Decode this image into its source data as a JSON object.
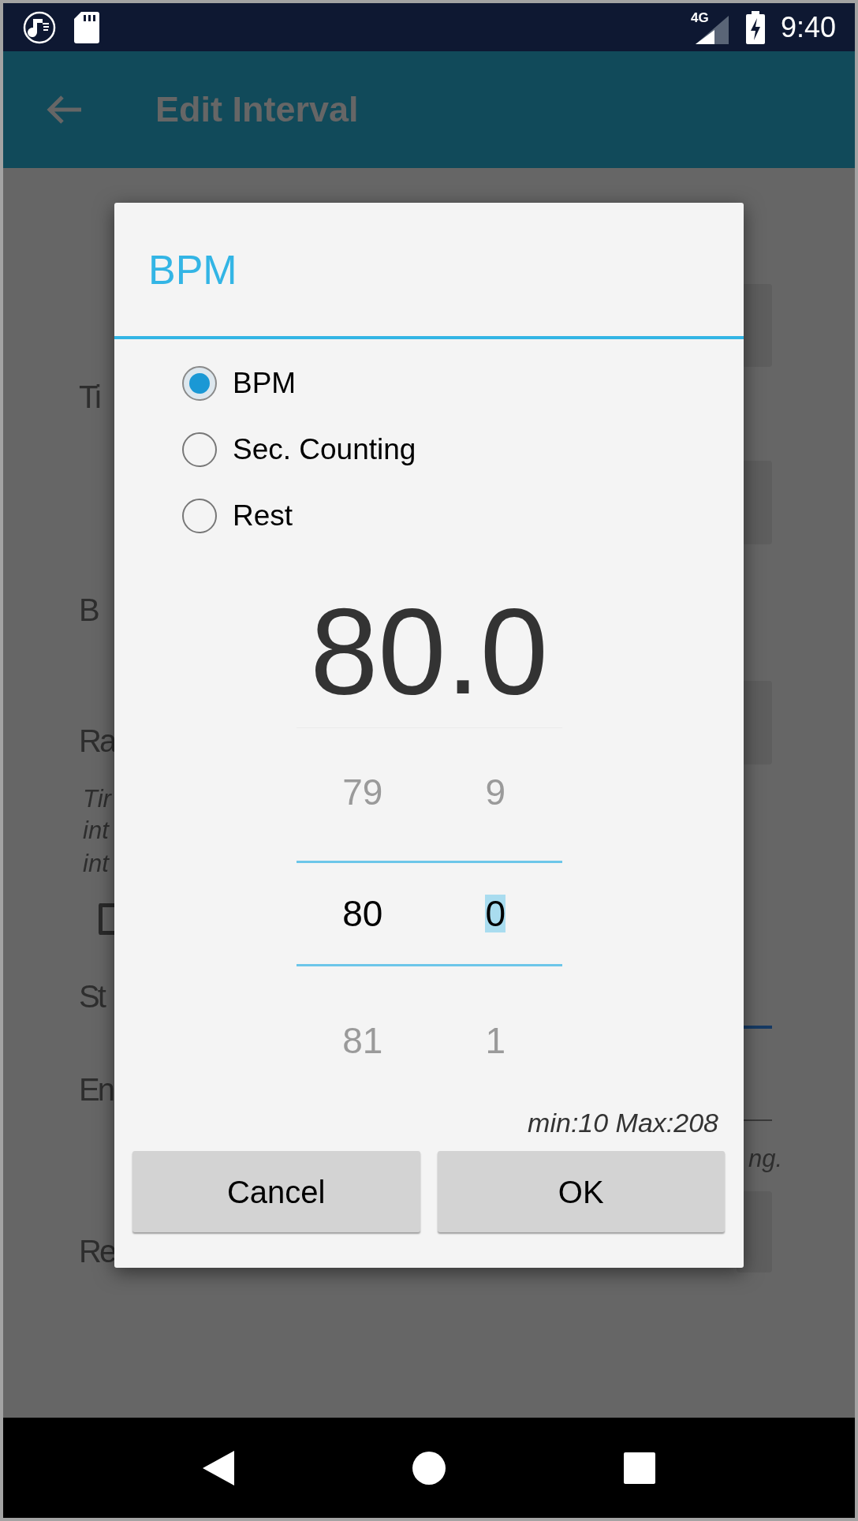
{
  "status_bar": {
    "network": "4G",
    "time": "9:40"
  },
  "app_bar": {
    "title": "Edit Interval"
  },
  "background": {
    "left": [
      {
        "kind": "label",
        "text": "Ti"
      },
      {
        "kind": "label",
        "text": "B"
      },
      {
        "kind": "label",
        "text": "Ra"
      },
      {
        "kind": "hint",
        "text": "Tir"
      },
      {
        "kind": "hint",
        "text": "int"
      },
      {
        "kind": "hint",
        "text": "int"
      },
      {
        "kind": "checkbox",
        "checked": false
      },
      {
        "kind": "label",
        "text": "St"
      },
      {
        "kind": "label",
        "text": "En"
      },
      {
        "kind": "label",
        "text": "Re"
      }
    ],
    "right_hint": "ng."
  },
  "dialog": {
    "title": "BPM",
    "options": [
      {
        "label": "BPM",
        "selected": true
      },
      {
        "label": "Sec. Counting",
        "selected": false
      },
      {
        "label": "Rest",
        "selected": false
      }
    ],
    "display": "80.0",
    "picker": [
      {
        "above": "79",
        "value": "80",
        "below": "81",
        "highlighted": false
      },
      {
        "above": "9",
        "value": "0",
        "below": "1",
        "highlighted": true
      }
    ],
    "range": "min:10 Max:208",
    "buttons": [
      "Cancel",
      "OK"
    ]
  }
}
